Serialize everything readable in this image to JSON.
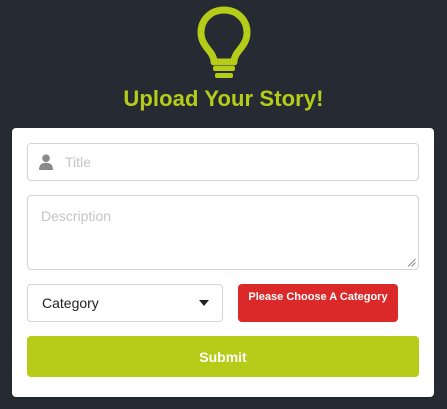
{
  "page": {
    "heading": "Upload Your Story!",
    "icon": "lightbulb-icon",
    "accent_color": "#b5cc18",
    "background_color": "#262b33"
  },
  "form": {
    "title": {
      "placeholder": "Title",
      "value": "",
      "icon": "user-icon"
    },
    "description": {
      "placeholder": "Description",
      "value": ""
    },
    "category": {
      "selected": "Category",
      "icon": "caret-down-icon"
    },
    "category_error": {
      "text": "Please Choose A Category",
      "color": "#db2828"
    },
    "submit_label": "Submit"
  }
}
